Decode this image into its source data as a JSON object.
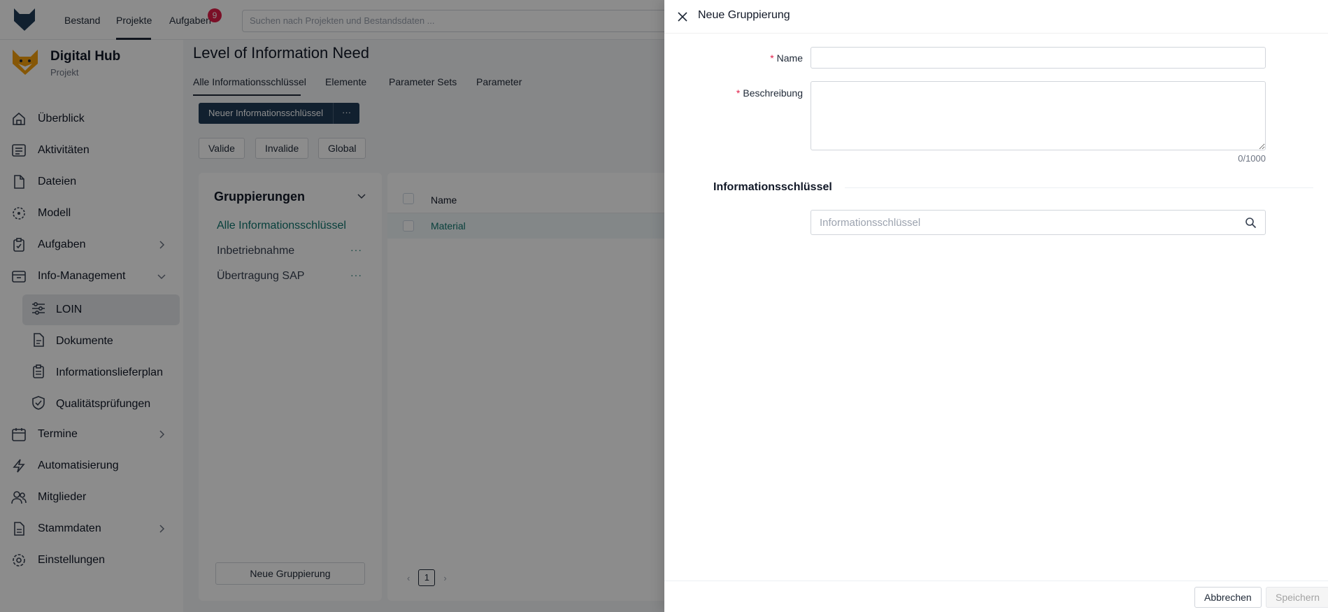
{
  "topbar": {
    "nav": [
      "Bestand",
      "Projekte",
      "Aufgaben"
    ],
    "active_nav": "Projekte",
    "tasks_badge": "9",
    "search_placeholder": "Suchen nach Projekten und Bestandsdaten ..."
  },
  "project": {
    "title": "Digital Hub",
    "subtitle": "Projekt"
  },
  "sidebar": {
    "items": [
      {
        "label": "Überblick",
        "icon": "home-icon"
      },
      {
        "label": "Aktivitäten",
        "icon": "activity-icon"
      },
      {
        "label": "Dateien",
        "icon": "file-icon"
      },
      {
        "label": "Modell",
        "icon": "model-icon"
      },
      {
        "label": "Aufgaben",
        "icon": "tasks-icon"
      },
      {
        "label": "Info-Management",
        "icon": "inbox-icon"
      },
      {
        "label": "Termine",
        "icon": "calendar-icon"
      },
      {
        "label": "Automatisierung",
        "icon": "bolt-icon"
      },
      {
        "label": "Mitglieder",
        "icon": "users-icon"
      },
      {
        "label": "Stammdaten",
        "icon": "document-icon"
      },
      {
        "label": "Einstellungen",
        "icon": "gear-icon"
      }
    ],
    "sub_items": [
      {
        "label": "LOIN",
        "icon": "sliders-icon"
      },
      {
        "label": "Dokumente",
        "icon": "doc-icon"
      },
      {
        "label": "Informationslieferplan",
        "icon": "clipboard-icon"
      },
      {
        "label": "Qualitätsprüfungen",
        "icon": "shield-icon"
      }
    ]
  },
  "main": {
    "title": "Level of Information Need",
    "tabs": [
      "Alle Informationsschlüssel",
      "Elemente",
      "Parameter Sets",
      "Parameter"
    ],
    "new_button": "Neuer Informationsschlüssel",
    "more_button": "···",
    "filters": [
      "Valide",
      "Invalide",
      "Global"
    ],
    "groups": {
      "title": "Gruppierungen",
      "items": [
        "Alle Informationsschlüssel",
        "Inbetriebnahme",
        "Übertragung SAP"
      ],
      "dots": "···",
      "new_button": "Neue Gruppierung"
    },
    "table": {
      "header_name": "Name",
      "rows": [
        "Material"
      ],
      "page": "1"
    }
  },
  "drawer": {
    "title": "Neue Gruppierung",
    "required_mark": "*",
    "name_label": "Name",
    "name_value": "",
    "description_label": "Beschreibung",
    "description_value": "",
    "char_count": "0/1000",
    "section_title": "Informationsschlüssel",
    "search_placeholder": "Informationsschlüssel",
    "cancel_label": "Abbrechen",
    "save_label": "Speichern"
  },
  "colors": {
    "primary": "#1f3b57",
    "accent": "#0f766e",
    "required": "#e11d48"
  }
}
